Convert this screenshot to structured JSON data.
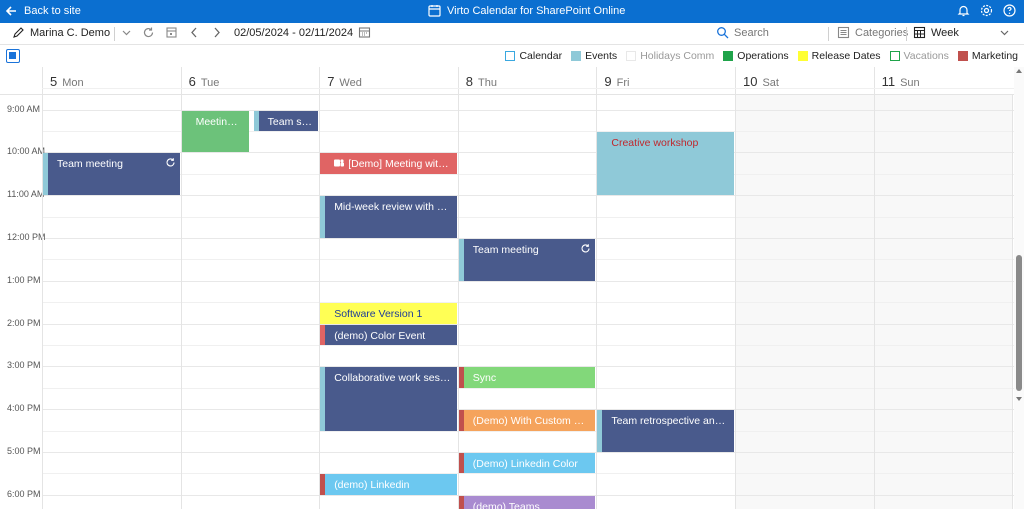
{
  "topbar": {
    "back_label": "Back to site",
    "app_title": "Virto Calendar for SharePoint Online",
    "bg_color": "#0b6fd0"
  },
  "toolbar": {
    "user": "Marina C. Demo",
    "date_range": "02/05/2024 - 02/11/2024",
    "search_placeholder": "Search",
    "categories_label": "Categories",
    "view_label": "Week"
  },
  "legend": [
    {
      "label": "Calendar",
      "color": "#3aa8e0",
      "style": "outline"
    },
    {
      "label": "Events",
      "color": "#8fc9d8",
      "style": "fill"
    },
    {
      "label": "Holidays Comm",
      "color": "#e8e8e8",
      "style": "outline",
      "dim": true
    },
    {
      "label": "Operations",
      "color": "#1fa34a",
      "style": "fill"
    },
    {
      "label": "Release Dates",
      "color": "#ffff33",
      "style": "fill"
    },
    {
      "label": "Vacations",
      "color": "#1fa34a",
      "style": "outline",
      "dim": true
    },
    {
      "label": "Marketing",
      "color": "#c0504d",
      "style": "fill"
    }
  ],
  "days": [
    {
      "num": "5",
      "name": "Mon"
    },
    {
      "num": "6",
      "name": "Tue"
    },
    {
      "num": "7",
      "name": "Wed"
    },
    {
      "num": "8",
      "name": "Thu"
    },
    {
      "num": "9",
      "name": "Fri"
    },
    {
      "num": "10",
      "name": "Sat"
    },
    {
      "num": "11",
      "name": "Sun"
    }
  ],
  "hours": [
    "9:00 AM",
    "10:00 AM",
    "11:00 AM",
    "12:00 PM",
    "1:00 PM",
    "2:00 PM",
    "3:00 PM",
    "4:00 PM",
    "5:00 PM",
    "6:00 PM"
  ],
  "events": [
    {
      "title": "Meeting wi...",
      "day": 1,
      "start": 9.0,
      "end": 10.0,
      "color": "#6cc27a",
      "border": "#6cc27a",
      "col_start": 0,
      "col_span": 0.5
    },
    {
      "title": "Team stan...",
      "day": 1,
      "start": 9.0,
      "end": 9.5,
      "color": "#495a8c",
      "border": "#8fc9d8",
      "col_start": 0.52,
      "col_span": 0.48
    },
    {
      "title": "Team meeting",
      "day": 0,
      "start": 10.0,
      "end": 11.0,
      "color": "#495a8c",
      "border": "#8fc9d8",
      "recurring": true
    },
    {
      "title": "[Demo] Meeting with Kris",
      "day": 2,
      "start": 10.0,
      "end": 10.5,
      "color": "#e06464",
      "border": "#e06464",
      "teams": true
    },
    {
      "title": "Mid-week review with man...",
      "day": 2,
      "start": 11.0,
      "end": 12.0,
      "color": "#495a8c",
      "border": "#8fc9d8"
    },
    {
      "title": "Team meeting",
      "day": 3,
      "start": 12.0,
      "end": 13.0,
      "color": "#495a8c",
      "border": "#8fc9d8",
      "recurring": true
    },
    {
      "title": "Software Version 1",
      "day": 2,
      "start": 13.5,
      "end": 14.0,
      "color": "#ffff55",
      "border": "#ffff55",
      "dark": true,
      "text_color": "#1f3d99"
    },
    {
      "title": "(demo) Color Event",
      "day": 2,
      "start": 14.0,
      "end": 14.5,
      "color": "#495a8c",
      "border": "#e06464"
    },
    {
      "title": "Collaborative work session...",
      "day": 2,
      "start": 15.0,
      "end": 16.5,
      "color": "#495a8c",
      "border": "#8fc9d8"
    },
    {
      "title": "Sync",
      "day": 3,
      "start": 15.0,
      "end": 15.5,
      "color": "#82d87a",
      "border": "#c0504d"
    },
    {
      "title": "(Demo) With Custom Color",
      "day": 3,
      "start": 16.0,
      "end": 16.5,
      "color": "#f5a35c",
      "border": "#c0504d"
    },
    {
      "title": "(Demo) Linkedin Color",
      "day": 3,
      "start": 17.0,
      "end": 17.5,
      "color": "#6cc8f0",
      "border": "#c0504d"
    },
    {
      "title": "(demo) Linkedin",
      "day": 2,
      "start": 17.5,
      "end": 18.0,
      "color": "#6cc8f0",
      "border": "#c0504d"
    },
    {
      "title": "(demo) Teams",
      "day": 3,
      "start": 18.0,
      "end": 18.5,
      "color": "#a98bd0",
      "border": "#c0504d"
    },
    {
      "title": "Creative workshop",
      "day": 4,
      "start": 9.5,
      "end": 11.0,
      "color": "#8fc9d8",
      "border": "#8fc9d8",
      "dark": true,
      "text_color": "#c0282d"
    },
    {
      "title": "Team retrospective and pla...",
      "day": 4,
      "start": 16.0,
      "end": 17.0,
      "color": "#495a8c",
      "border": "#8fc9d8"
    }
  ]
}
